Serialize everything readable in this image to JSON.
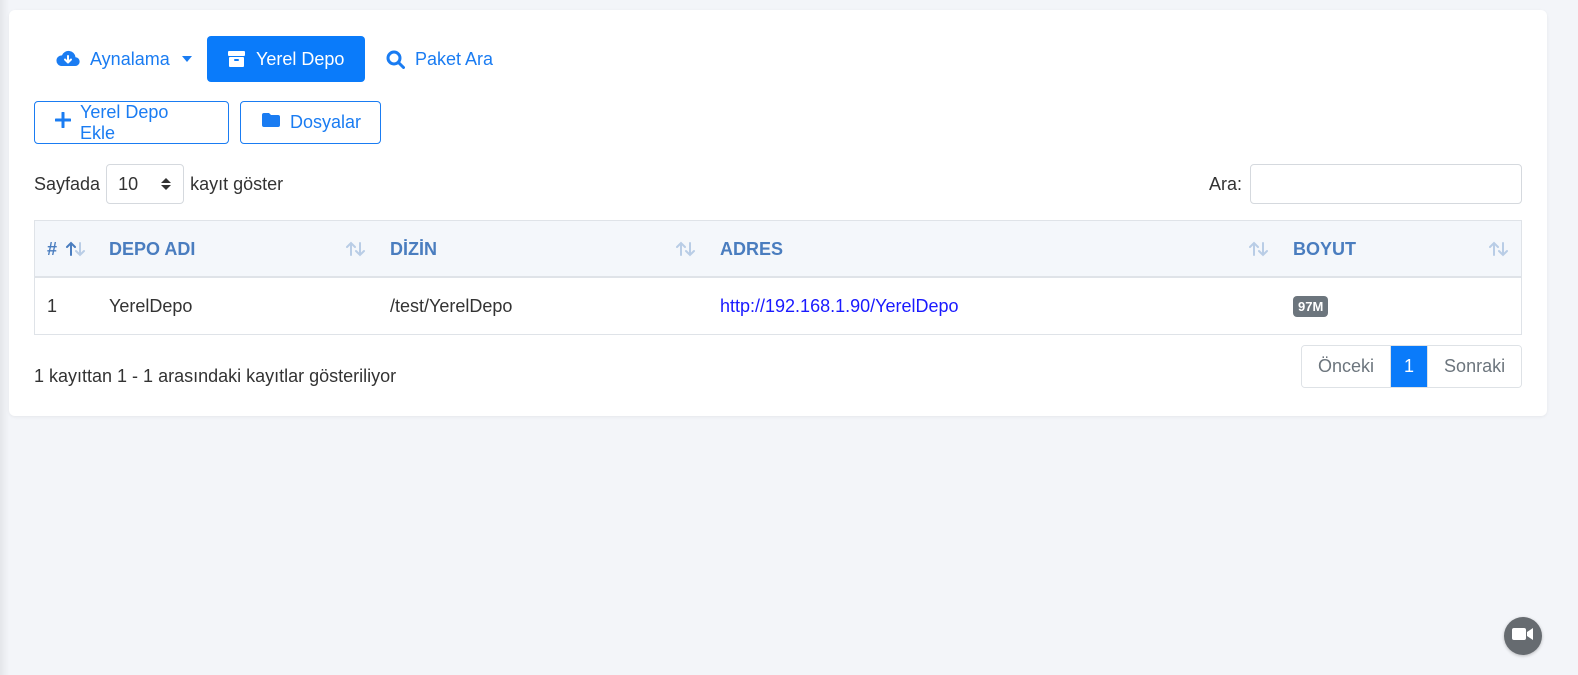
{
  "nav": {
    "mirror_label": "Aynalama",
    "local_repo_label": "Yerel Depo",
    "package_search_label": "Paket Ara"
  },
  "toolbar": {
    "add_local_repo_label": "Yerel Depo Ekle",
    "files_label": "Dosyalar"
  },
  "length_control": {
    "prefix": "Sayfada",
    "value": "10",
    "suffix": "kayıt göster"
  },
  "search": {
    "label": "Ara:",
    "value": ""
  },
  "table": {
    "columns": [
      "#",
      "DEPO ADI",
      "DİZİN",
      "ADRES",
      "BOYUT"
    ],
    "rows": [
      {
        "index": "1",
        "name": "YerelDepo",
        "dir": "/test/YerelDepo",
        "address": "http://192.168.1.90/YerelDepo",
        "size": "97M"
      }
    ]
  },
  "info_text": "1 kayıttan 1 - 1 arasındaki kayıtlar gösteriliyor",
  "pagination": {
    "prev_label": "Önceki",
    "current_page": "1",
    "next_label": "Sonraki"
  },
  "colors": {
    "accent": "#0a7bfa",
    "header_text": "#4a7dbf",
    "badge": "#6c757d"
  },
  "icons": [
    "cloud-download-icon",
    "box-icon",
    "search-icon",
    "plus-icon",
    "folder-icon",
    "sort-icon",
    "video-camera-icon"
  ]
}
